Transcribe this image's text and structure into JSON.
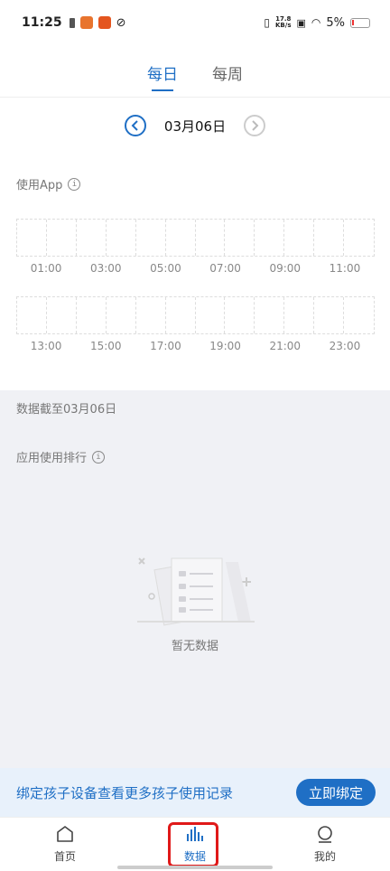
{
  "status_bar": {
    "time": "11:25",
    "net_speed_top": "17.8",
    "net_speed_bottom": "KB/s",
    "battery": "5%"
  },
  "tabs": [
    {
      "label": "每日",
      "active": true
    },
    {
      "label": "每周",
      "active": false
    }
  ],
  "date_nav": {
    "date": "03月06日"
  },
  "usage": {
    "title": "使用App",
    "hours_row1": [
      "01:00",
      "03:00",
      "05:00",
      "07:00",
      "09:00",
      "11:00"
    ],
    "hours_row2": [
      "13:00",
      "15:00",
      "17:00",
      "19:00",
      "21:00",
      "23:00"
    ]
  },
  "data_note": "数据截至03月06日",
  "ranking": {
    "title": "应用使用排行",
    "empty_text": "暂无数据"
  },
  "bind_banner": {
    "text": "绑定孩子设备查看更多孩子使用记录",
    "button": "立即绑定"
  },
  "bottom_nav": [
    {
      "label": "首页",
      "icon": "home-icon"
    },
    {
      "label": "数据",
      "icon": "bar-chart-icon",
      "active": true
    },
    {
      "label": "我的",
      "icon": "profile-icon"
    }
  ],
  "colors": {
    "accent": "#1f6fc5",
    "highlight": "#e01919",
    "gray_bg": "#f0f1f5"
  }
}
